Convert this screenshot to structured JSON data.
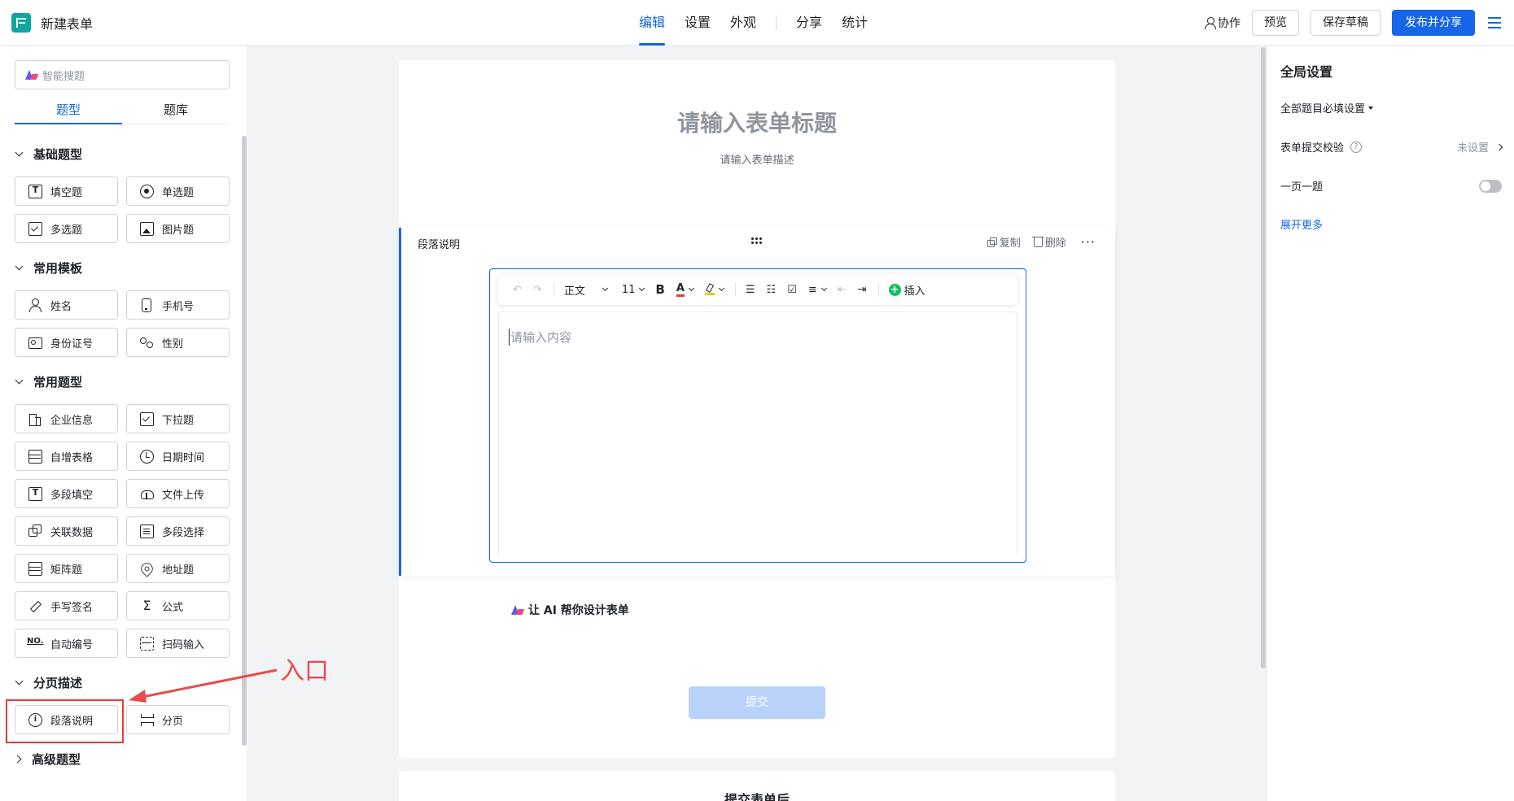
{
  "header": {
    "doc_title": "新建表单",
    "nav": [
      "编辑",
      "设置",
      "外观",
      "分享",
      "统计"
    ],
    "collab": "协作",
    "preview": "预览",
    "save_draft": "保存草稿",
    "publish": "发布并分享"
  },
  "left": {
    "ai_search_placeholder": "智能搜题",
    "tabs": [
      "题型",
      "题库"
    ],
    "groups": {
      "basic": "基础题型",
      "templates": "常用模板",
      "common": "常用题型",
      "paging": "分页描述",
      "advanced": "高级题型"
    },
    "items": {
      "fill": "填空题",
      "single": "单选题",
      "multi": "多选题",
      "image": "图片题",
      "name": "姓名",
      "phone": "手机号",
      "idcard": "身份证号",
      "gender": "性别",
      "company": "企业信息",
      "dropdown": "下拉题",
      "table": "自增表格",
      "datetime": "日期时间",
      "multifill": "多段填空",
      "upload": "文件上传",
      "linked": "关联数据",
      "multiselect": "多段选择",
      "matrix": "矩阵题",
      "address": "地址题",
      "signature": "手写签名",
      "formula": "公式",
      "autonum": "自动编号",
      "scan": "扫码输入",
      "paragraph": "段落说明",
      "pagebreak": "分页"
    }
  },
  "annotation": {
    "label": "入口",
    "color": "#e84b4b"
  },
  "canvas": {
    "form_title": "请输入表单标题",
    "form_desc": "请输入表单描述",
    "block_label": "段落说明",
    "copy": "复制",
    "delete": "删除",
    "toolbar": {
      "style": "正文",
      "size": "11",
      "bold": "B",
      "font_color": "A",
      "insert": "插入"
    },
    "editor_placeholder": "请输入内容",
    "ai_design": "让 AI 帮你设计表单",
    "submit": "提交",
    "after_submit": "提交表单后"
  },
  "right": {
    "title": "全局设置",
    "required_setting": "全部题目必填设置",
    "submit_check": "表单提交校验",
    "submit_check_value": "未设置",
    "one_per_page": "一页一题",
    "expand_more": "展开更多"
  },
  "colors": {
    "primary": "#1665e8",
    "annotation_red": "#e83a3a"
  }
}
